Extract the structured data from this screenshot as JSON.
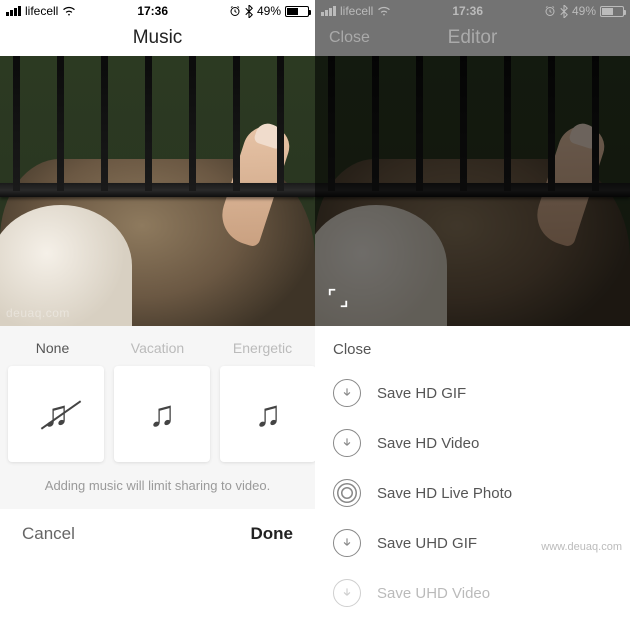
{
  "left": {
    "status": {
      "carrier": "lifecell",
      "time": "17:36",
      "alarm": "⏰",
      "bluetooth": "✱",
      "battery_pct": "49%"
    },
    "nav": {
      "title": "Music"
    },
    "tabs": [
      "None",
      "Vacation",
      "Energetic"
    ],
    "hint": "Adding music will limit sharing to video.",
    "buttons": {
      "cancel": "Cancel",
      "done": "Done"
    }
  },
  "right": {
    "status": {
      "carrier": "lifecell",
      "time": "17:36",
      "alarm": "⏰",
      "bluetooth": "✱",
      "battery_pct": "49%"
    },
    "nav": {
      "left": "Close",
      "title": "Editor"
    },
    "sheet": {
      "close": "Close",
      "items": [
        "Save HD GIF",
        "Save HD Video",
        "Save HD Live Photo",
        "Save UHD GIF",
        "Save UHD Video"
      ]
    }
  },
  "watermark": {
    "left": "deuaq.com",
    "right": "www.deuaq.com"
  }
}
